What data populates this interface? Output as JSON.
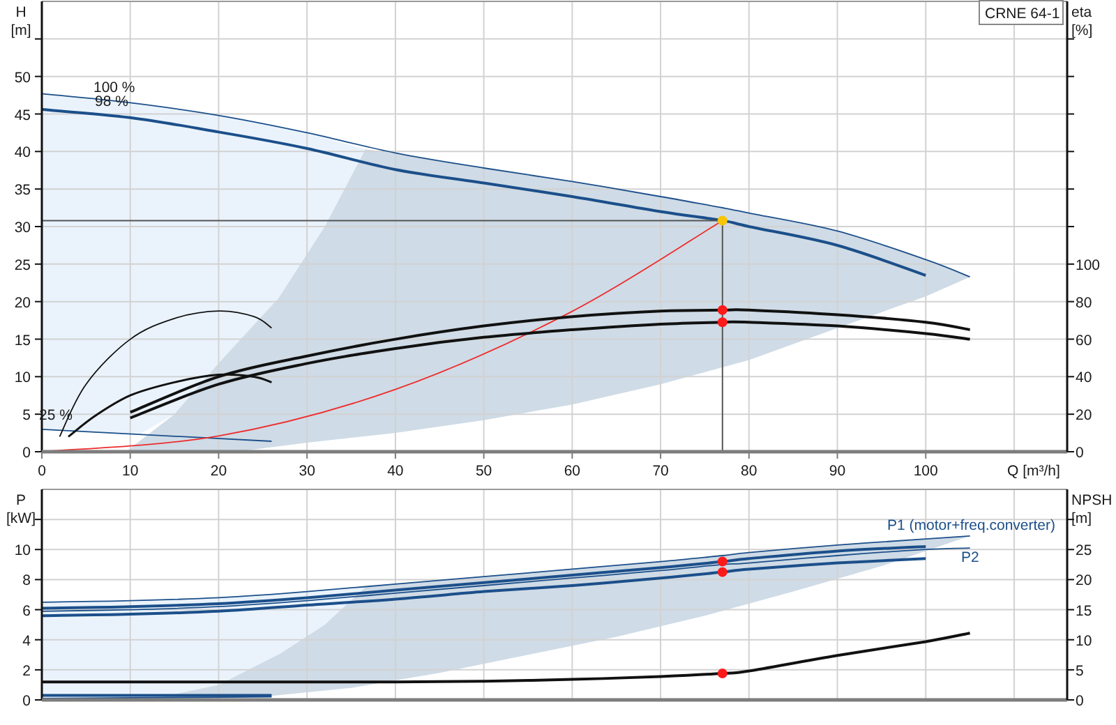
{
  "head_chart": {
    "chart_data": {
      "type": "line",
      "title": "CRNE 64-1",
      "xlabel": "Q [m³/h]",
      "ylabel": {
        "name": "H",
        "unit": "[m]"
      },
      "grid": true,
      "xlim": [
        0,
        116
      ],
      "ylim": [
        0,
        60
      ],
      "xticks": [
        0,
        10,
        20,
        30,
        40,
        50,
        60,
        70,
        80,
        90,
        100
      ],
      "yticks": [
        0,
        5,
        10,
        15,
        20,
        25,
        30,
        35,
        40,
        45,
        50
      ],
      "x": [
        0,
        10,
        20,
        30,
        40,
        50,
        60,
        70,
        77,
        80,
        90,
        100,
        105
      ],
      "series": [
        {
          "name": "100 %",
          "color": "#1b4f8a",
          "values": [
            47.7,
            46.5,
            44.8,
            42.5,
            39.8,
            37.8,
            36,
            34,
            32.5,
            31.8,
            29.4,
            25.6,
            23.3
          ]
        },
        {
          "name": "98 %",
          "color": "#1b4f8a",
          "x": [
            0,
            10,
            20,
            30,
            40,
            50,
            60,
            70,
            77,
            80,
            90,
            100
          ],
          "values": [
            45.6,
            44.5,
            42.6,
            40.4,
            37.6,
            35.8,
            34,
            32,
            30.8,
            30,
            27.5,
            23.5
          ]
        },
        {
          "name": "25 %",
          "color": "#1b4f8a",
          "x": [
            0,
            26
          ],
          "values": [
            3.0,
            1.4
          ]
        },
        {
          "color": "#ee2b2b",
          "x": [
            0,
            20,
            40,
            60,
            77
          ],
          "values": [
            0,
            2.1,
            8.3,
            18.7,
            30.8
          ]
        },
        {
          "color": "#555555",
          "x": [
            0,
            77
          ],
          "values": [
            30.8,
            30.8
          ]
        },
        {
          "color": "#555555",
          "x": [
            77,
            77
          ],
          "values": [
            0,
            30.8
          ]
        },
        {
          "color": "#f7c600",
          "marker": "circle",
          "x": [
            77
          ],
          "values": [
            30.8
          ]
        }
      ]
    }
  },
  "efficiency_chart": {
    "chart_data": {
      "type": "line",
      "ylabel": {
        "name": "eta",
        "unit": "[%]"
      },
      "xlim": [
        0,
        116
      ],
      "ylim": [
        0,
        240
      ],
      "yticks": [
        0,
        20,
        40,
        60,
        80,
        100
      ],
      "x": [
        10,
        20,
        30,
        40,
        50,
        60,
        70,
        77,
        80,
        90,
        100,
        105
      ],
      "series": [
        {
          "color": "#111111",
          "values": [
            21,
            40,
            51,
            60,
            67,
            72,
            75,
            75.5,
            75.5,
            73,
            69,
            65
          ]
        },
        {
          "color": "#111111",
          "values": [
            18,
            36,
            47,
            55,
            61,
            65,
            68,
            69,
            69,
            67,
            63,
            60
          ]
        },
        {
          "color": "#111111",
          "x": [
            2,
            5,
            10,
            15,
            20,
            24,
            26
          ],
          "values": [
            8,
            36,
            60,
            71,
            75,
            72,
            66
          ]
        },
        {
          "color": "#111111",
          "x": [
            3,
            6,
            10,
            15,
            20,
            24,
            26
          ],
          "values": [
            8,
            19,
            30,
            37,
            41,
            40,
            37
          ]
        },
        {
          "color": "#ff1a1a",
          "marker": "circle",
          "x": [
            77
          ],
          "values": [
            75.5
          ]
        },
        {
          "color": "#ff1a1a",
          "marker": "circle",
          "x": [
            77
          ],
          "values": [
            69
          ]
        }
      ]
    }
  },
  "power_chart": {
    "chart_data": {
      "type": "line",
      "ylabel": {
        "name": "P",
        "unit": "[kW]"
      },
      "grid": true,
      "xlim": [
        0,
        116
      ],
      "ylim": [
        0,
        14
      ],
      "yticks": [
        0,
        2,
        4,
        6,
        8,
        10
      ],
      "x": [
        0,
        10,
        20,
        30,
        40,
        50,
        60,
        70,
        77,
        80,
        90,
        100,
        105
      ],
      "series": [
        {
          "name": "P1 (motor+freq.converter)",
          "color": "#1b4f8a",
          "values": [
            6.5,
            6.6,
            6.8,
            7.2,
            7.7,
            8.2,
            8.7,
            9.2,
            9.6,
            9.8,
            10.3,
            10.7,
            10.9
          ]
        },
        {
          "color": "#1b4f8a",
          "x": [
            0,
            10,
            20,
            30,
            40,
            50,
            60,
            70,
            77,
            80,
            90,
            100
          ],
          "values": [
            6.1,
            6.2,
            6.4,
            6.8,
            7.3,
            7.8,
            8.3,
            8.8,
            9.2,
            9.4,
            9.9,
            10.2
          ]
        },
        {
          "name": "P2",
          "color": "#1b4f8a",
          "values": [
            5.9,
            6.0,
            6.2,
            6.6,
            7.1,
            7.6,
            8.1,
            8.6,
            9.0,
            9.1,
            9.6,
            10.0,
            10.1
          ]
        },
        {
          "color": "#1b4f8a",
          "x": [
            0,
            10,
            20,
            30,
            40,
            50,
            60,
            70,
            77,
            80,
            90,
            100
          ],
          "values": [
            5.6,
            5.7,
            5.9,
            6.3,
            6.7,
            7.2,
            7.6,
            8.1,
            8.5,
            8.7,
            9.1,
            9.4
          ]
        },
        {
          "color": "#1b4f8a",
          "x": [
            0,
            26
          ],
          "values": [
            0.3,
            0.3
          ]
        },
        {
          "color": "#1b4f8a",
          "x": [
            0,
            26
          ],
          "values": [
            0.1,
            0.2
          ]
        },
        {
          "color": "#ff1a1a",
          "marker": "circle",
          "x": [
            77
          ],
          "values": [
            9.2
          ]
        },
        {
          "color": "#ff1a1a",
          "marker": "circle",
          "x": [
            77
          ],
          "values": [
            8.5
          ]
        }
      ]
    }
  },
  "npsh_chart": {
    "chart_data": {
      "type": "line",
      "ylabel": {
        "name": "NPSH",
        "unit": "[m]"
      },
      "xlim": [
        0,
        116
      ],
      "ylim": [
        0,
        35
      ],
      "yticks": [
        0,
        5,
        10,
        15,
        20,
        25
      ],
      "x": [
        0,
        10,
        20,
        30,
        40,
        50,
        60,
        70,
        77,
        80,
        90,
        100,
        105
      ],
      "series": [
        {
          "color": "#111111",
          "values": [
            3,
            3,
            3,
            3,
            3,
            3.1,
            3.4,
            3.9,
            4.4,
            4.8,
            7.4,
            9.7,
            11.1
          ]
        },
        {
          "color": "#ff1a1a",
          "marker": "circle",
          "x": [
            77
          ],
          "values": [
            4.4
          ]
        }
      ]
    }
  }
}
